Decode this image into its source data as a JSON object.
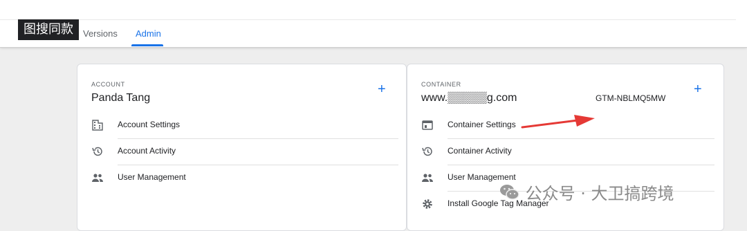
{
  "overlay_badge": "图搜同款",
  "tabs": [
    {
      "label": "Versions",
      "active": false
    },
    {
      "label": "Admin",
      "active": true
    }
  ],
  "account": {
    "section_label": "ACCOUNT",
    "name": "Panda Tang",
    "add_label": "+",
    "items": [
      {
        "label": "Account Settings",
        "icon": "building-icon"
      },
      {
        "label": "Account Activity",
        "icon": "history-icon"
      },
      {
        "label": "User Management",
        "icon": "people-icon"
      }
    ]
  },
  "container": {
    "section_label": "CONTAINER",
    "name": "www.▒▒▒▒▒g.com",
    "id": "GTM-NBLMQ5MW",
    "add_label": "+",
    "items": [
      {
        "label": "Container Settings",
        "icon": "window-icon"
      },
      {
        "label": "Container Activity",
        "icon": "history-icon"
      },
      {
        "label": "User Management",
        "icon": "people-icon"
      },
      {
        "label": "Install Google Tag Manager",
        "icon": "gear-icon"
      }
    ]
  },
  "watermark": "公众号 · 大卫搞跨境",
  "colors": {
    "accent": "#1a73e8",
    "annotation_arrow": "#e53935"
  }
}
